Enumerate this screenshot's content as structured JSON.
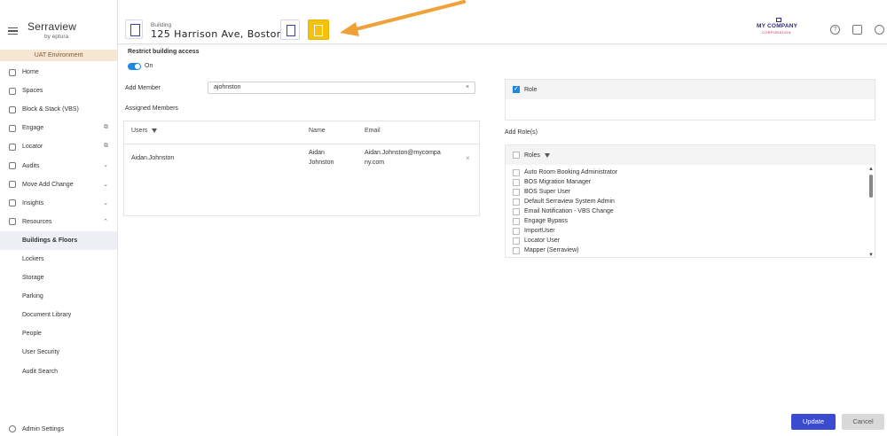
{
  "app": {
    "logo": "Serraview",
    "logo_sub": "by eptura",
    "environment": "UAT Environment"
  },
  "sidebar": {
    "items": [
      {
        "label": "Home",
        "icon": "home-icon"
      },
      {
        "label": "Spaces",
        "icon": "spaces-icon"
      },
      {
        "label": "Block & Stack (VBS)",
        "icon": "block-stack-icon"
      },
      {
        "label": "Engage",
        "icon": "engage-icon",
        "trail": "⧉"
      },
      {
        "label": "Locator",
        "icon": "locator-icon",
        "trail": "⧉"
      },
      {
        "label": "Audits",
        "icon": "audits-icon",
        "trail": "⌄"
      },
      {
        "label": "Move Add Change",
        "icon": "move-add-change-icon",
        "trail": "⌄"
      },
      {
        "label": "Insights",
        "icon": "insights-icon",
        "trail": "⌄"
      },
      {
        "label": "Resources",
        "icon": "resources-icon",
        "trail": "⌃"
      }
    ],
    "sub_items": [
      {
        "label": "Buildings & Floors",
        "active": true
      },
      {
        "label": "Lockers"
      },
      {
        "label": "Storage"
      },
      {
        "label": "Parking"
      },
      {
        "label": "Document Library"
      },
      {
        "label": "People"
      },
      {
        "label": "User Security"
      },
      {
        "label": "Audit Search"
      }
    ],
    "admin_settings": "Admin Settings"
  },
  "header": {
    "building_label": "Building",
    "building_name": "125 Harrison Ave, Boston",
    "company": "MY COMPANY",
    "company_sub": "CORPORATION",
    "help_icon": "?",
    "folder_icon": "folder-icon",
    "user_icon": "user-icon"
  },
  "main": {
    "restrict_title": "Restrict building access",
    "toggle_label": "On",
    "toggle_on": true,
    "add_member_label": "Add Member",
    "add_member_value": "ajohnston",
    "clear_icon": "×",
    "assigned_members_label": "Assigned Members",
    "table": {
      "headers": [
        "Users",
        "Name",
        "Email"
      ],
      "rows": [
        {
          "user": "Aidan.Johnston",
          "name_line1": "Aidan",
          "name_line2": "Johnston",
          "email_line1": "Aidan.Johnston@mycompa",
          "email_line2": "ny.com"
        }
      ]
    },
    "role_header": "Role",
    "role_checked": true,
    "add_roles_label": "Add Role(s)",
    "roles_header": "Roles",
    "roles": [
      "Auto Room Booking Administrator",
      "BOS Migration Manager",
      "BOS Super User",
      "Default Serraview System Admin",
      "Email Notification - VBS Change",
      "Engage Bypass",
      "ImportUser",
      "Locator User",
      "Mapper (Serraview)"
    ]
  },
  "footer": {
    "update_label": "Update",
    "cancel_label": "Cancel"
  },
  "colors": {
    "accent": "#3a4bd0",
    "highlight": "#f3c20f",
    "annotation_arrow": "#f0a23a",
    "toggle": "#1e88e5"
  }
}
